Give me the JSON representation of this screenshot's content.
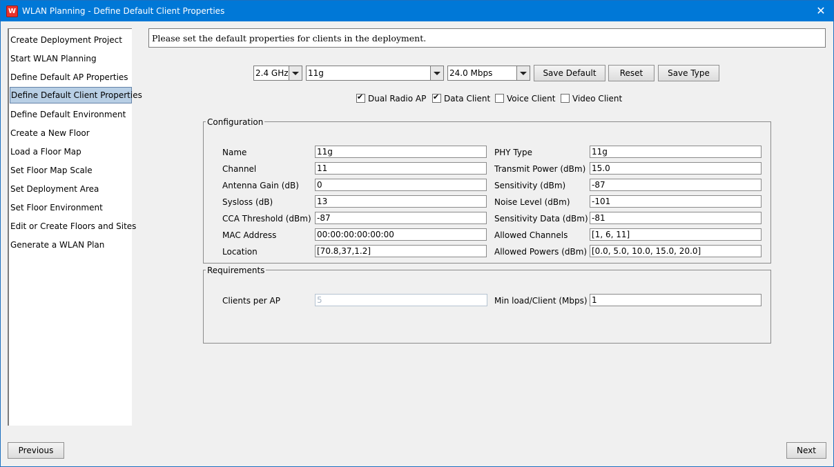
{
  "window": {
    "title": "WLAN Planning - Define Default Client Properties",
    "close_glyph": "✕",
    "app_icon_letter": "W"
  },
  "sidebar": {
    "steps": [
      {
        "label": "Create Deployment Project"
      },
      {
        "label": "Start WLAN Planning"
      },
      {
        "label": "Define Default AP Properties"
      },
      {
        "label": "Define Default Client Properties",
        "active": true
      },
      {
        "label": "Define Default Environment"
      },
      {
        "label": "Create a New Floor"
      },
      {
        "label": "Load a Floor Map"
      },
      {
        "label": "Set Floor Map Scale"
      },
      {
        "label": "Set Deployment Area"
      },
      {
        "label": "Set Floor Environment"
      },
      {
        "label": "Edit or Create Floors and Sites"
      },
      {
        "label": "Generate a WLAN Plan"
      }
    ]
  },
  "instruction": "Please set the default properties for clients in the deployment.",
  "toolbar": {
    "band": "2.4 GHz",
    "type": "11g",
    "rate": "24.0 Mbps",
    "save_default": "Save Default",
    "reset": "Reset",
    "save_type": "Save Type"
  },
  "options": {
    "dual_radio_ap": {
      "label": "Dual Radio AP",
      "checked": true
    },
    "data_client": {
      "label": "Data Client",
      "checked": true
    },
    "voice_client": {
      "label": "Voice Client",
      "checked": false
    },
    "video_client": {
      "label": "Video Client",
      "checked": false
    }
  },
  "configuration": {
    "title": "Configuration",
    "left": [
      {
        "label": "Name",
        "value": "11g"
      },
      {
        "label": "Channel",
        "value": "11"
      },
      {
        "label": "Antenna Gain (dB)",
        "value": "0"
      },
      {
        "label": "Sysloss (dB)",
        "value": "13"
      },
      {
        "label": "CCA Threshold (dBm)",
        "value": "-87"
      },
      {
        "label": "MAC Address",
        "value": "00:00:00:00:00:00"
      },
      {
        "label": "Location",
        "value": "[70.8,37,1.2]"
      }
    ],
    "right": [
      {
        "label": "PHY Type",
        "value": "11g"
      },
      {
        "label": "Transmit Power (dBm)",
        "value": "15.0"
      },
      {
        "label": "Sensitivity (dBm)",
        "value": "-87"
      },
      {
        "label": "Noise Level (dBm)",
        "value": "-101"
      },
      {
        "label": "Sensitivity Data (dBm)",
        "value": "-81"
      },
      {
        "label": "Allowed Channels",
        "value": "[1, 6, 11]"
      },
      {
        "label": "Allowed Powers (dBm)",
        "value": "[0.0, 5.0, 10.0, 15.0, 20.0]"
      }
    ]
  },
  "requirements": {
    "title": "Requirements",
    "clients_per_ap": {
      "label": "Clients per AP",
      "value": "5"
    },
    "min_load": {
      "label": "Min load/Client (Mbps)",
      "value": "1"
    }
  },
  "nav": {
    "previous": "Previous",
    "next": "Next"
  }
}
